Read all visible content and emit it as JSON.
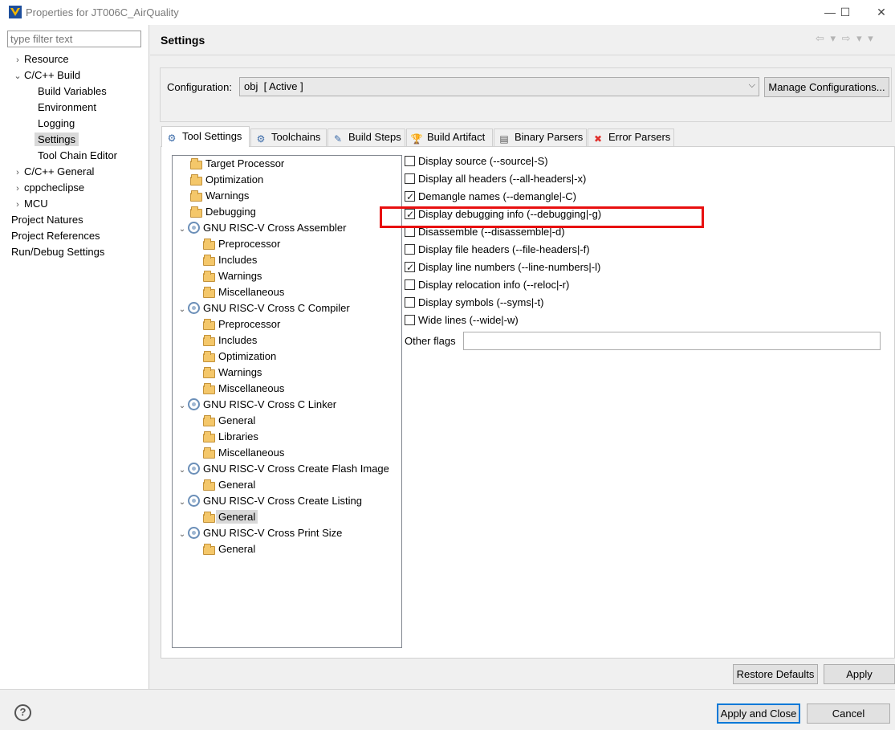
{
  "window": {
    "title": "Properties for JT006C_AirQuality",
    "controls": {
      "minimize": "—",
      "maximize": "☐",
      "close": "✕"
    }
  },
  "sidebar": {
    "filter_placeholder": "type filter text",
    "items": [
      {
        "label": "Resource",
        "arrow": "›"
      },
      {
        "label": "C/C++ Build",
        "arrow": "⌄"
      },
      {
        "label": "Build Variables"
      },
      {
        "label": "Environment"
      },
      {
        "label": "Logging"
      },
      {
        "label": "Settings"
      },
      {
        "label": "Tool Chain Editor"
      },
      {
        "label": "C/C++ General",
        "arrow": "›"
      },
      {
        "label": "cppcheclipse",
        "arrow": "›"
      },
      {
        "label": "MCU",
        "arrow": "›"
      },
      {
        "label": "Project Natures"
      },
      {
        "label": "Project References"
      },
      {
        "label": "Run/Debug Settings"
      }
    ]
  },
  "header": {
    "title": "Settings",
    "nav": "⇦ ▾ ⇨ ▾ ▾"
  },
  "configuration": {
    "label": "Configuration:",
    "value": "obj  [ Active ]",
    "manage_button": "Manage Configurations..."
  },
  "tabs": [
    {
      "label": "Tool Settings",
      "icon": "⚙"
    },
    {
      "label": "Toolchains",
      "icon": "⚙"
    },
    {
      "label": "Build Steps",
      "icon": "✎"
    },
    {
      "label": "Build Artifact",
      "icon": "🏆"
    },
    {
      "label": "Binary Parsers",
      "icon": "▤"
    },
    {
      "label": "Error Parsers",
      "icon": "✖"
    }
  ],
  "tool_tree": [
    {
      "label": "Target Processor",
      "type": "folder"
    },
    {
      "label": "Optimization",
      "type": "folder"
    },
    {
      "label": "Warnings",
      "type": "folder"
    },
    {
      "label": "Debugging",
      "type": "folder"
    },
    {
      "label": "GNU RISC-V Cross Assembler",
      "type": "tool"
    },
    {
      "label": "Preprocessor",
      "type": "folder"
    },
    {
      "label": "Includes",
      "type": "folder"
    },
    {
      "label": "Warnings",
      "type": "folder"
    },
    {
      "label": "Miscellaneous",
      "type": "folder"
    },
    {
      "label": "GNU RISC-V Cross C Compiler",
      "type": "tool"
    },
    {
      "label": "Preprocessor",
      "type": "folder"
    },
    {
      "label": "Includes",
      "type": "folder"
    },
    {
      "label": "Optimization",
      "type": "folder"
    },
    {
      "label": "Warnings",
      "type": "folder"
    },
    {
      "label": "Miscellaneous",
      "type": "folder"
    },
    {
      "label": "GNU RISC-V Cross C Linker",
      "type": "tool"
    },
    {
      "label": "General",
      "type": "folder"
    },
    {
      "label": "Libraries",
      "type": "folder"
    },
    {
      "label": "Miscellaneous",
      "type": "folder"
    },
    {
      "label": "GNU RISC-V Cross Create Flash Image",
      "type": "tool"
    },
    {
      "label": "General",
      "type": "folder"
    },
    {
      "label": "GNU RISC-V Cross Create Listing",
      "type": "tool"
    },
    {
      "label": "General",
      "type": "folder",
      "selected": true
    },
    {
      "label": "GNU RISC-V Cross Print Size",
      "type": "tool"
    },
    {
      "label": "General",
      "type": "folder"
    }
  ],
  "options": [
    {
      "label": "Display source (--source|-S)",
      "checked": false
    },
    {
      "label": "Display all headers (--all-headers|-x)",
      "checked": false
    },
    {
      "label": "Demangle names (--demangle|-C)",
      "checked": true
    },
    {
      "label": "Display debugging info (--debugging|-g)",
      "checked": true
    },
    {
      "label": "Disassemble (--disassemble|-d)",
      "checked": false
    },
    {
      "label": "Display file headers (--file-headers|-f)",
      "checked": false
    },
    {
      "label": "Display line numbers (--line-numbers|-l)",
      "checked": true
    },
    {
      "label": "Display relocation info (--reloc|-r)",
      "checked": false
    },
    {
      "label": "Display symbols (--syms|-t)",
      "checked": false
    },
    {
      "label": "Wide lines (--wide|-w)",
      "checked": false
    }
  ],
  "other_flags": {
    "label": "Other flags",
    "value": ""
  },
  "buttons": {
    "restore": "Restore Defaults",
    "apply": "Apply",
    "apply_close": "Apply and Close",
    "cancel": "Cancel",
    "help": "?"
  },
  "colors": {
    "highlight": "#e81010",
    "accent": "#0078d7"
  }
}
